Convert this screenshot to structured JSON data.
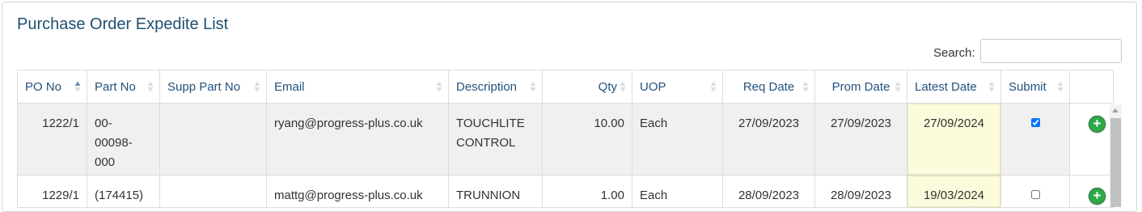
{
  "title": "Purchase Order Expedite List",
  "search": {
    "label": "Search:",
    "value": ""
  },
  "columns": [
    {
      "label": "PO No",
      "sort": "asc"
    },
    {
      "label": "Part No",
      "sort": "none"
    },
    {
      "label": "Supp Part No",
      "sort": "none"
    },
    {
      "label": "Email",
      "sort": "none"
    },
    {
      "label": "Description",
      "sort": "none"
    },
    {
      "label": "Qty",
      "sort": "none"
    },
    {
      "label": "UOP",
      "sort": "none"
    },
    {
      "label": "Req Date",
      "sort": "none"
    },
    {
      "label": "Prom Date",
      "sort": "none"
    },
    {
      "label": "Latest Date",
      "sort": "none"
    },
    {
      "label": "Submit",
      "sort": "none"
    },
    {
      "label": "",
      "sort": "none"
    }
  ],
  "rows": [
    {
      "po_no": "1222/1",
      "part_no_lines": [
        "00-",
        "00098-",
        "000"
      ],
      "supp_part_no": "",
      "email": "ryang@progress-plus.co.uk",
      "description_lines": [
        "TOUCHLITE",
        "CONTROL"
      ],
      "qty": "10.00",
      "uop": "Each",
      "req_date": "27/09/2023",
      "prom_date": "27/09/2023",
      "latest_date": "27/09/2024",
      "submit_checked": true,
      "action_icon": "plus-circle-icon"
    },
    {
      "po_no": "1229/1",
      "part_no_lines": [
        "(174415)"
      ],
      "supp_part_no": "",
      "email": "mattg@progress-plus.co.uk",
      "description_lines": [
        "TRUNNION"
      ],
      "qty": "1.00",
      "uop": "Each",
      "req_date": "28/09/2023",
      "prom_date": "28/09/2023",
      "latest_date": "19/03/2024",
      "submit_checked": false,
      "action_icon": "plus-circle-icon"
    }
  ],
  "colors": {
    "title": "#1e4f6f",
    "header_text": "#23527c",
    "row_alt": "#f0f0f0",
    "date_edit_bg": "#fcfcdc",
    "add_button": "#2ea84b"
  }
}
